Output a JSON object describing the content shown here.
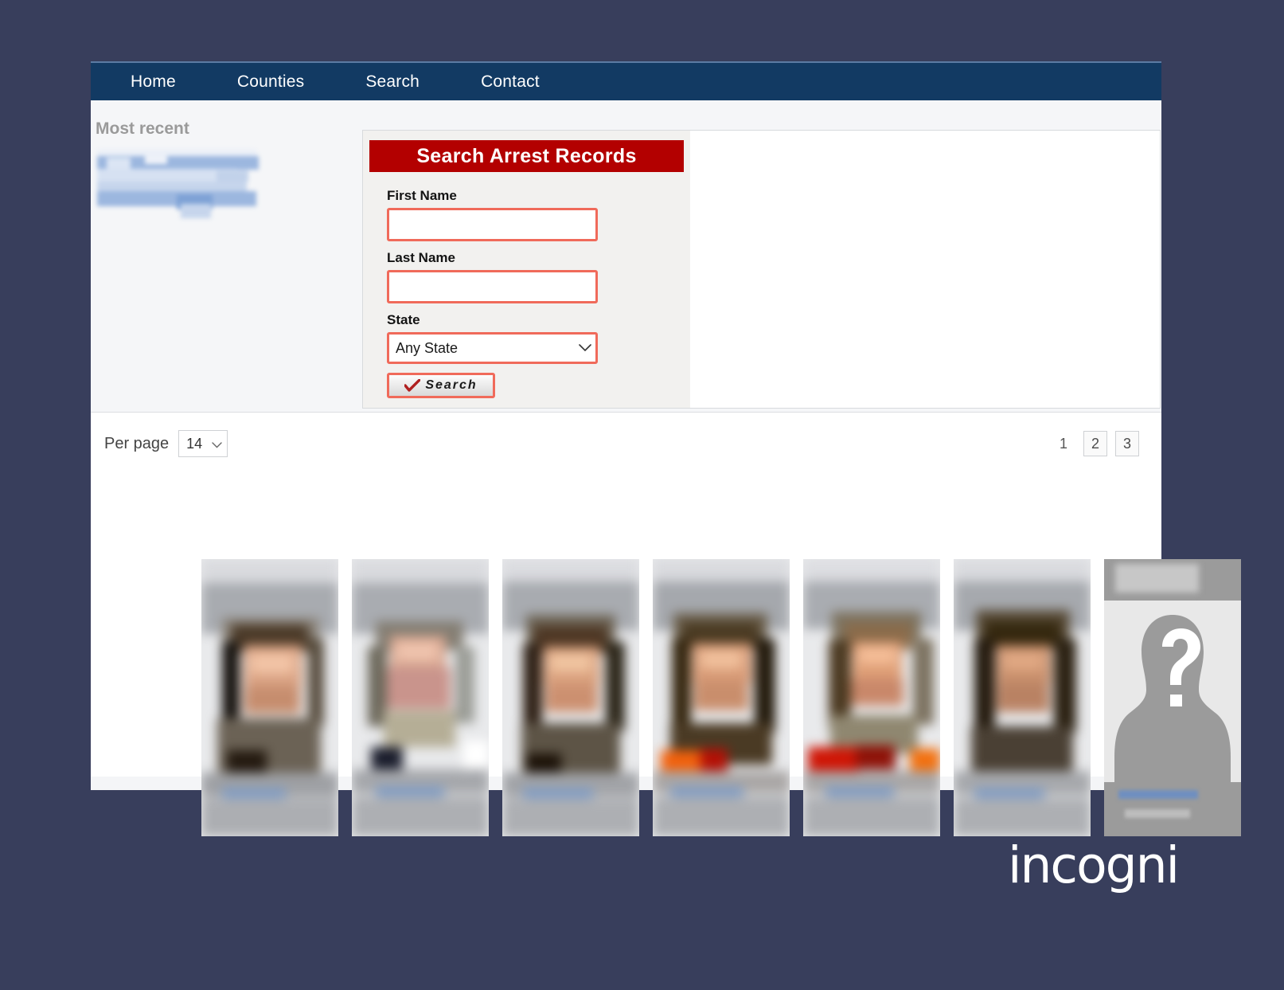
{
  "page": {
    "background_color": "#383e5c",
    "brand_logo_text": "incogni"
  },
  "nav": {
    "items": [
      {
        "label": "Home"
      },
      {
        "label": "Counties"
      },
      {
        "label": "Search"
      },
      {
        "label": "Contact"
      }
    ],
    "background_color": "#123a63",
    "text_color": "#ffffff"
  },
  "sidebar": {
    "title": "Most recent",
    "redacted_links": [
      {
        "note": "blurred link 1"
      },
      {
        "note": "blurred link 2"
      },
      {
        "note": "blurred link 3"
      },
      {
        "note": "blurred link 4"
      }
    ]
  },
  "search_form": {
    "header": "Search Arrest Records",
    "header_color": "#b30000",
    "accent_border_color": "#f06a5a",
    "fields": [
      {
        "label": "First Name",
        "value": "",
        "placeholder": ""
      },
      {
        "label": "Last Name",
        "value": "",
        "placeholder": ""
      }
    ],
    "state": {
      "label": "State",
      "selected": "Any State",
      "options": [
        "Any State"
      ]
    },
    "submit": {
      "label": "Search",
      "icon": "checkmark-icon"
    }
  },
  "results": {
    "per_page": {
      "label": "Per page",
      "selected": "14",
      "options": [
        "14"
      ]
    },
    "pagination": {
      "current": "1",
      "pages": [
        {
          "label": "1",
          "current": true
        },
        {
          "label": "2",
          "current": false
        },
        {
          "label": "3",
          "current": false
        }
      ]
    },
    "cards": [
      {
        "name": "mugshot-card-1",
        "redacted": true,
        "has_photo": true
      },
      {
        "name": "mugshot-card-2",
        "redacted": true,
        "has_photo": true
      },
      {
        "name": "mugshot-card-3",
        "redacted": true,
        "has_photo": true
      },
      {
        "name": "mugshot-card-4",
        "redacted": true,
        "has_photo": true
      },
      {
        "name": "mugshot-card-5",
        "redacted": true,
        "has_photo": true
      },
      {
        "name": "mugshot-card-6",
        "redacted": true,
        "has_photo": true
      },
      {
        "name": "mugshot-card-7",
        "redacted": true,
        "has_photo": false,
        "placeholder_icon": "question-mark-silhouette-icon"
      }
    ]
  }
}
